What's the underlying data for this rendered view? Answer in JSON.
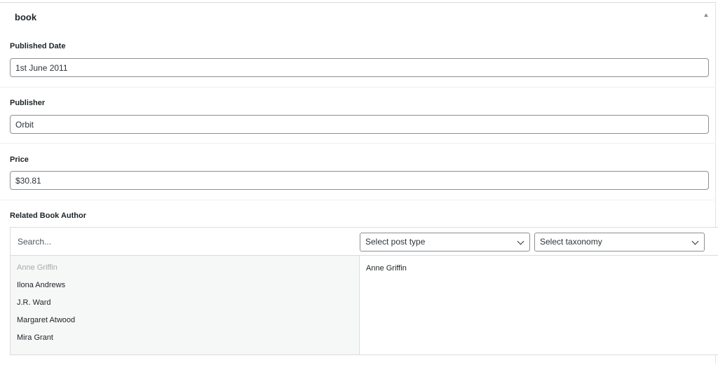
{
  "panel": {
    "title": "book"
  },
  "fields": {
    "published_date": {
      "label": "Published Date",
      "value": "1st June 2011"
    },
    "publisher": {
      "label": "Publisher",
      "value": "Orbit"
    },
    "price": {
      "label": "Price",
      "value": "$30.81"
    }
  },
  "related": {
    "label": "Related Book Author",
    "search_placeholder": "Search...",
    "post_type_select": "Select post type",
    "taxonomy_select": "Select taxonomy",
    "choices": [
      {
        "label": "Anne Griffin",
        "disabled": true
      },
      {
        "label": "Ilona Andrews",
        "disabled": false
      },
      {
        "label": "J.R. Ward",
        "disabled": false
      },
      {
        "label": "Margaret Atwood",
        "disabled": false
      },
      {
        "label": "Mira Grant",
        "disabled": false
      }
    ],
    "selected": [
      "Anne Griffin"
    ]
  }
}
